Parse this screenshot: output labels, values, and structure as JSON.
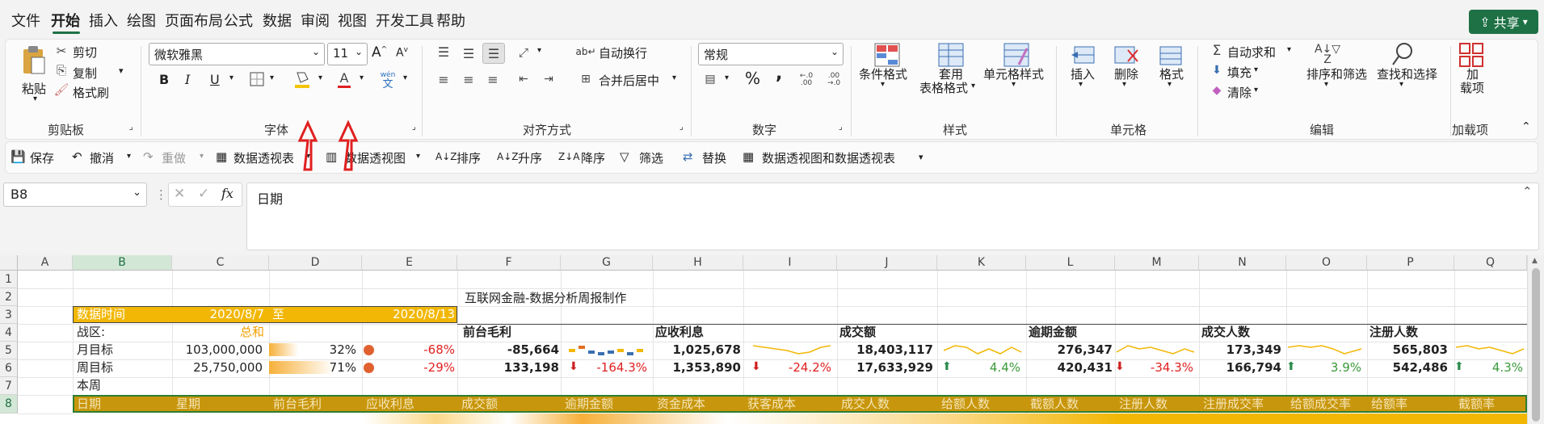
{
  "menu": {
    "items": [
      "文件",
      "开始",
      "插入",
      "绘图",
      "页面布局",
      "公式",
      "数据",
      "审阅",
      "视图",
      "开发工具",
      "帮助"
    ],
    "share": "共享"
  },
  "ribbon": {
    "clipboard": {
      "paste": "粘贴",
      "cut": "剪切",
      "copy": "复制",
      "format_painter": "格式刷",
      "label": "剪贴板"
    },
    "font": {
      "name": "微软雅黑",
      "size": "11",
      "label": "字体",
      "bold": "B",
      "italic": "I",
      "underline": "U",
      "grow": "A",
      "shrink": "A",
      "color": "A",
      "phonetic_top": "wén",
      "phonetic_bottom": "文"
    },
    "align": {
      "wrap": "自动换行",
      "merge": "合并后居中",
      "label": "对齐方式"
    },
    "number": {
      "format": "常规",
      "label": "数字",
      "percent": "%",
      "comma": ","
    },
    "styles": {
      "conditional_1": "条件格式",
      "table_1": "套用",
      "table_2": "表格格式",
      "cell_styles": "单元格样式",
      "label": "样式"
    },
    "cells": {
      "insert": "插入",
      "delete": "删除",
      "format": "格式",
      "label": "单元格"
    },
    "editing": {
      "autosum": "自动求和",
      "fill": "填充",
      "clear": "清除",
      "sort_filter": "排序和筛选",
      "find_select": "查找和选择",
      "label": "编辑"
    },
    "addins": {
      "addin_1": "加",
      "addin_2": "载项",
      "label": "加载项"
    }
  },
  "qat": {
    "save": "保存",
    "undo": "撤消",
    "redo": "重做",
    "pivot_table": "数据透视表",
    "pivot_view": "数据透视图",
    "sort": "排序",
    "sort_asc": "升序",
    "sort_desc": "降序",
    "filter": "筛选",
    "replace": "替换",
    "pivot_both": "数据透视图和数据透视表"
  },
  "formula": {
    "name_box": "B8",
    "fx": "fx",
    "content": "日期"
  },
  "columns": [
    "A",
    "B",
    "C",
    "D",
    "E",
    "F",
    "G",
    "H",
    "I",
    "J",
    "K",
    "L",
    "M",
    "N",
    "O",
    "P",
    "Q"
  ],
  "rows": [
    "1",
    "2",
    "3",
    "4",
    "5",
    "6",
    "7",
    "8"
  ],
  "sheet": {
    "title": "互联网金融-数据分析周报制作",
    "data_time_label": "数据时间",
    "date_from": "2020/8/7",
    "to": "至",
    "date_to": "2020/8/13",
    "region_label": "战区:",
    "region_value": "总和",
    "month_target": "月目标",
    "month_target_val": "103,000,000",
    "month_pct": "32%",
    "month_change": "-68%",
    "week_target": "周目标",
    "week_target_val": "25,750,000",
    "week_pct": "71%",
    "week_change": "-29%",
    "this_week": "本周",
    "kpis": [
      {
        "name": "前台毛利",
        "r5": "-85,664",
        "r6": "133,198",
        "chg": "-164.3%"
      },
      {
        "name": "应收利息",
        "r5": "1,025,678",
        "r6": "1,353,890",
        "chg": "-24.2%"
      },
      {
        "name": "成交额",
        "r5": "18,403,117",
        "r6": "17,633,929",
        "chg": "4.4%"
      },
      {
        "name": "逾期金额",
        "r5": "276,347",
        "r6": "420,431",
        "chg": "-34.3%"
      },
      {
        "name": "成交人数",
        "r5": "173,349",
        "r6": "166,794",
        "chg": "3.9%"
      },
      {
        "name": "注册人数",
        "r5": "565,803",
        "r6": "542,486",
        "chg": "4.3%"
      }
    ],
    "header_row": [
      "日期",
      "星期",
      "前台毛利",
      "应收利息",
      "成交额",
      "逾期金额",
      "资金成本",
      "获客成本",
      "成交人数",
      "给额人数",
      "截额人数",
      "注册人数",
      "注册成交率",
      "给额成交率",
      "给额率",
      "截额率"
    ]
  },
  "colors": {
    "accent": "#1e7145",
    "gold": "#f2b705",
    "header_gold": "#c8960c",
    "red": "#e02020",
    "green": "#3a9a3a"
  }
}
